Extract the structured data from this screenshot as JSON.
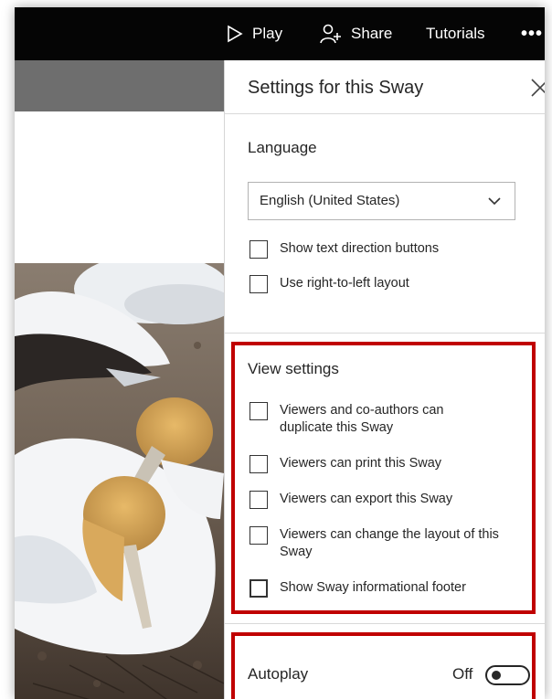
{
  "topbar": {
    "play_label": "Play",
    "share_label": "Share",
    "tutorials_label": "Tutorials",
    "more_label": "•••"
  },
  "panel": {
    "title": "Settings for this Sway",
    "language": {
      "label": "Language",
      "selected": "English (United States)"
    },
    "language_options": [
      "Show text direction buttons",
      "Use right-to-left layout"
    ],
    "view_settings": {
      "label": "View settings",
      "options": [
        "Viewers and co-authors can duplicate this Sway",
        "Viewers can print this Sway",
        "Viewers can export this Sway",
        "Viewers can change the layout of this Sway",
        "Show Sway informational footer"
      ]
    },
    "autoplay": {
      "label": "Autoplay",
      "state": "Off"
    }
  },
  "colors": {
    "highlight": "#c00000",
    "topbar": "#050505"
  },
  "icons": [
    "play-icon",
    "share-icon",
    "more-icon",
    "close-icon",
    "chevron-down-icon"
  ]
}
